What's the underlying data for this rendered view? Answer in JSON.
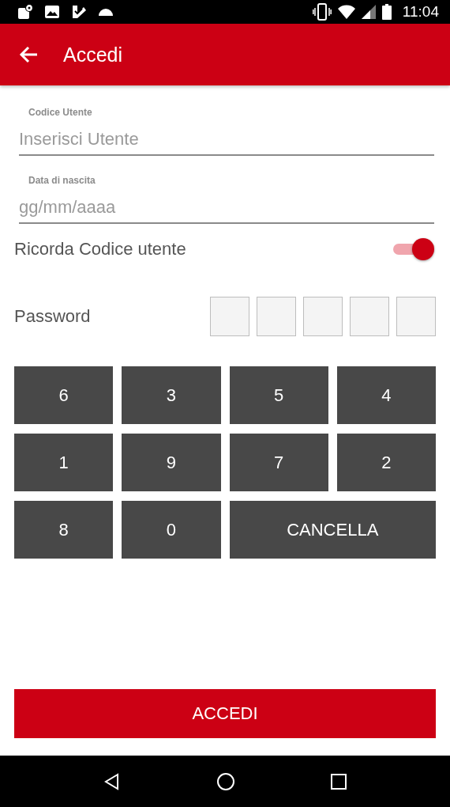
{
  "status_bar": {
    "time": "11:04"
  },
  "app_bar": {
    "title": "Accedi"
  },
  "fields": [
    {
      "label": "Codice Utente",
      "placeholder": "Inserisci Utente"
    },
    {
      "label": "Data di nascita",
      "placeholder": "gg/mm/aaaa"
    }
  ],
  "remember": {
    "label": "Ricorda Codice utente",
    "on": true
  },
  "password": {
    "label": "Password",
    "boxes": [
      {
        "filled": false
      },
      {
        "filled": false
      },
      {
        "filled": false
      },
      {
        "filled": false
      },
      {
        "filled": false
      }
    ]
  },
  "keypad": [
    {
      "kind": "digit",
      "label": "6"
    },
    {
      "kind": "digit",
      "label": "3"
    },
    {
      "kind": "digit",
      "label": "5"
    },
    {
      "kind": "digit",
      "label": "4"
    },
    {
      "kind": "digit",
      "label": "1"
    },
    {
      "kind": "digit",
      "label": "9"
    },
    {
      "kind": "digit",
      "label": "7"
    },
    {
      "kind": "digit",
      "label": "2"
    },
    {
      "kind": "digit",
      "label": "8"
    },
    {
      "kind": "digit",
      "label": "0"
    },
    {
      "kind": "delete",
      "label": "CANCELLA"
    }
  ],
  "submit": {
    "label": "ACCEDI"
  }
}
